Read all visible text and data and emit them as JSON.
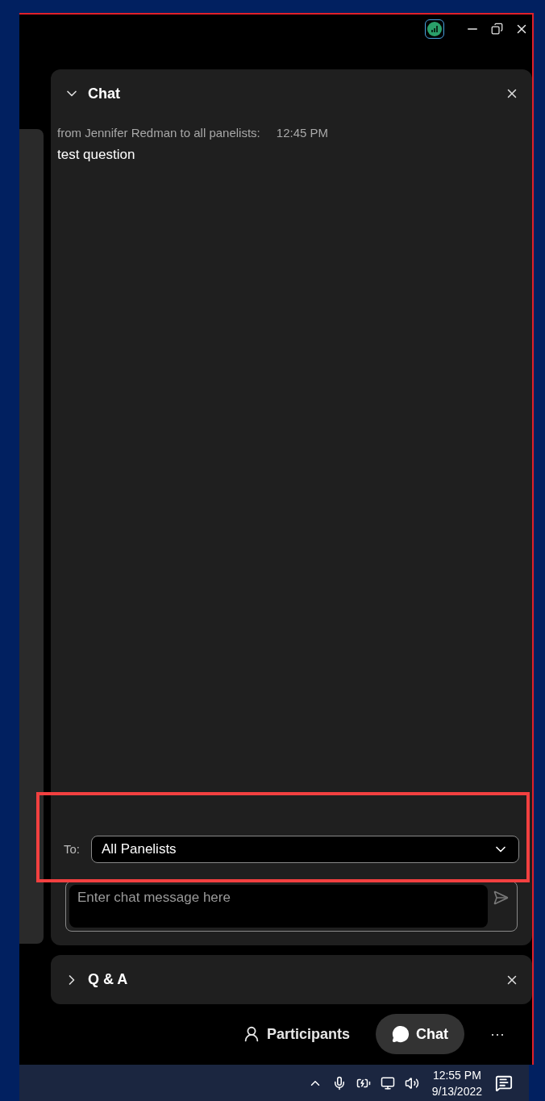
{
  "chat_panel": {
    "title": "Chat",
    "expanded": true,
    "messages": [
      {
        "header": "from Jennifer Redman to all panelists:",
        "time": "12:45 PM",
        "text": "test question"
      }
    ],
    "to_label": "To:",
    "recipient": "All Panelists",
    "input": {
      "placeholder": "Enter chat message here"
    }
  },
  "qa_panel": {
    "title": "Q & A",
    "expanded": false
  },
  "toolbar": [
    {
      "kind": "participants",
      "label": "Participants",
      "selected": false
    },
    {
      "kind": "chat",
      "label": "Chat",
      "selected": true
    },
    {
      "kind": "more",
      "label": "···",
      "selected": false
    }
  ],
  "taskbar": {
    "time": "12:55 PM",
    "date": "9/13/2022"
  }
}
